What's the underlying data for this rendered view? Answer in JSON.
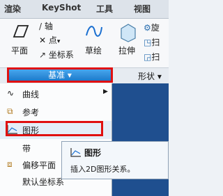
{
  "tabs": [
    "渲染",
    "KeyShot",
    "工具",
    "视图"
  ],
  "ribbon": {
    "plane": "平面",
    "axis": "轴",
    "point": "点",
    "coord_sys": "坐标系",
    "sketch": "草绘",
    "extrude": "拉伸",
    "revolve": "旋",
    "scan": "扫",
    "scan2": "扫"
  },
  "groups": {
    "datum": "基准 ▾",
    "shape": "形状 ▾"
  },
  "menu": {
    "curve": "曲线",
    "reference": "参考",
    "graph": "图形",
    "ribbon": "带",
    "offset_plane": "偏移平面",
    "default_csys": "默认坐标系"
  },
  "tooltip": {
    "title": "图形",
    "description": "插入2D图形关系。"
  },
  "colors": {
    "highlight_red": "#e01010",
    "group_blue": "#1a78c9",
    "workspace_blue": "#1f4f8f"
  }
}
